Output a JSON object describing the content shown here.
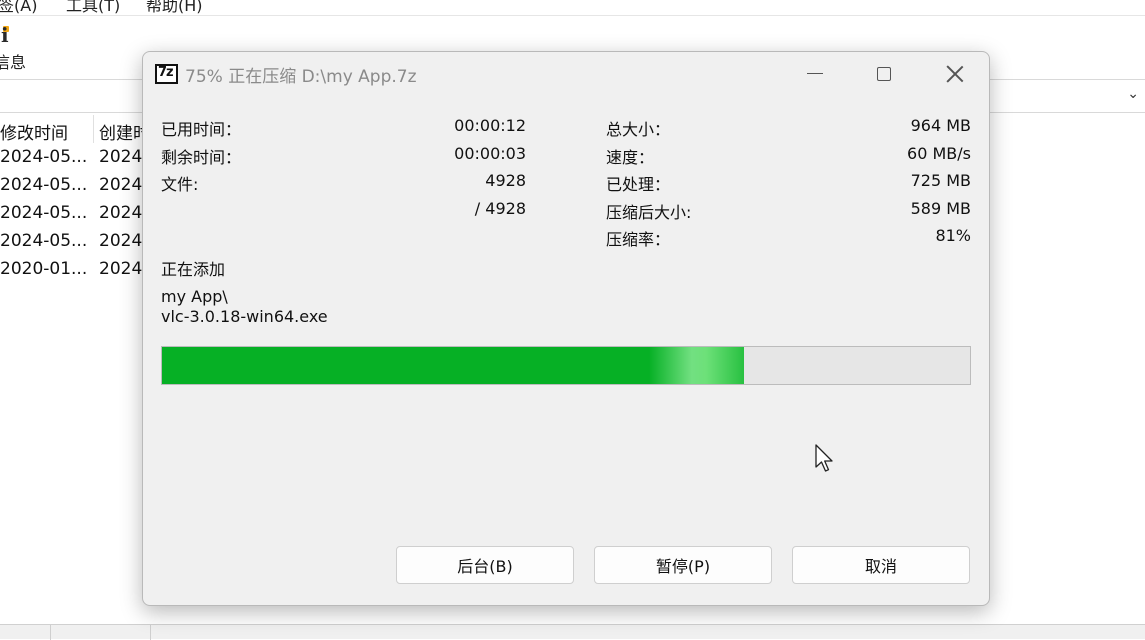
{
  "background_app": {
    "menu": [
      "签(A)",
      "工具(T)",
      "帮助(H)"
    ],
    "toolbar_info_label": "信息",
    "columns": [
      "修改时间",
      "创建时"
    ],
    "rows": [
      {
        "modified": "2024-05...",
        "created": "2024"
      },
      {
        "modified": "2024-05...",
        "created": "2024"
      },
      {
        "modified": "2024-05...",
        "created": "2024"
      },
      {
        "modified": "2024-05...",
        "created": "2024"
      },
      {
        "modified": "2020-01...",
        "created": "2024"
      }
    ]
  },
  "dialog": {
    "icon_text": "7z",
    "title": "75% 正在压缩 D:\\my App.7z",
    "left_stats": [
      {
        "label": "已用时间：",
        "value": "00:00:12"
      },
      {
        "label": "剩余时间：",
        "value": "00:00:03"
      },
      {
        "label": "文件:",
        "value": "4928"
      },
      {
        "label": "",
        "value": "/ 4928"
      }
    ],
    "right_stats": [
      {
        "label": "总大小：",
        "value": "964 MB"
      },
      {
        "label": "速度：",
        "value": "60 MB/s"
      },
      {
        "label": "已处理：",
        "value": "725 MB"
      },
      {
        "label": "压缩后大小:",
        "value": "589 MB"
      },
      {
        "label": "压缩率：",
        "value": "81%"
      }
    ],
    "status_label": "正在添加",
    "current_path": "my App\\",
    "current_file": "vlc-3.0.18-win64.exe",
    "progress_fraction": 0.72,
    "progress_color": "#06b025",
    "buttons": {
      "background": "后台(B)",
      "pause": "暂停(P)",
      "cancel": "取消"
    }
  }
}
